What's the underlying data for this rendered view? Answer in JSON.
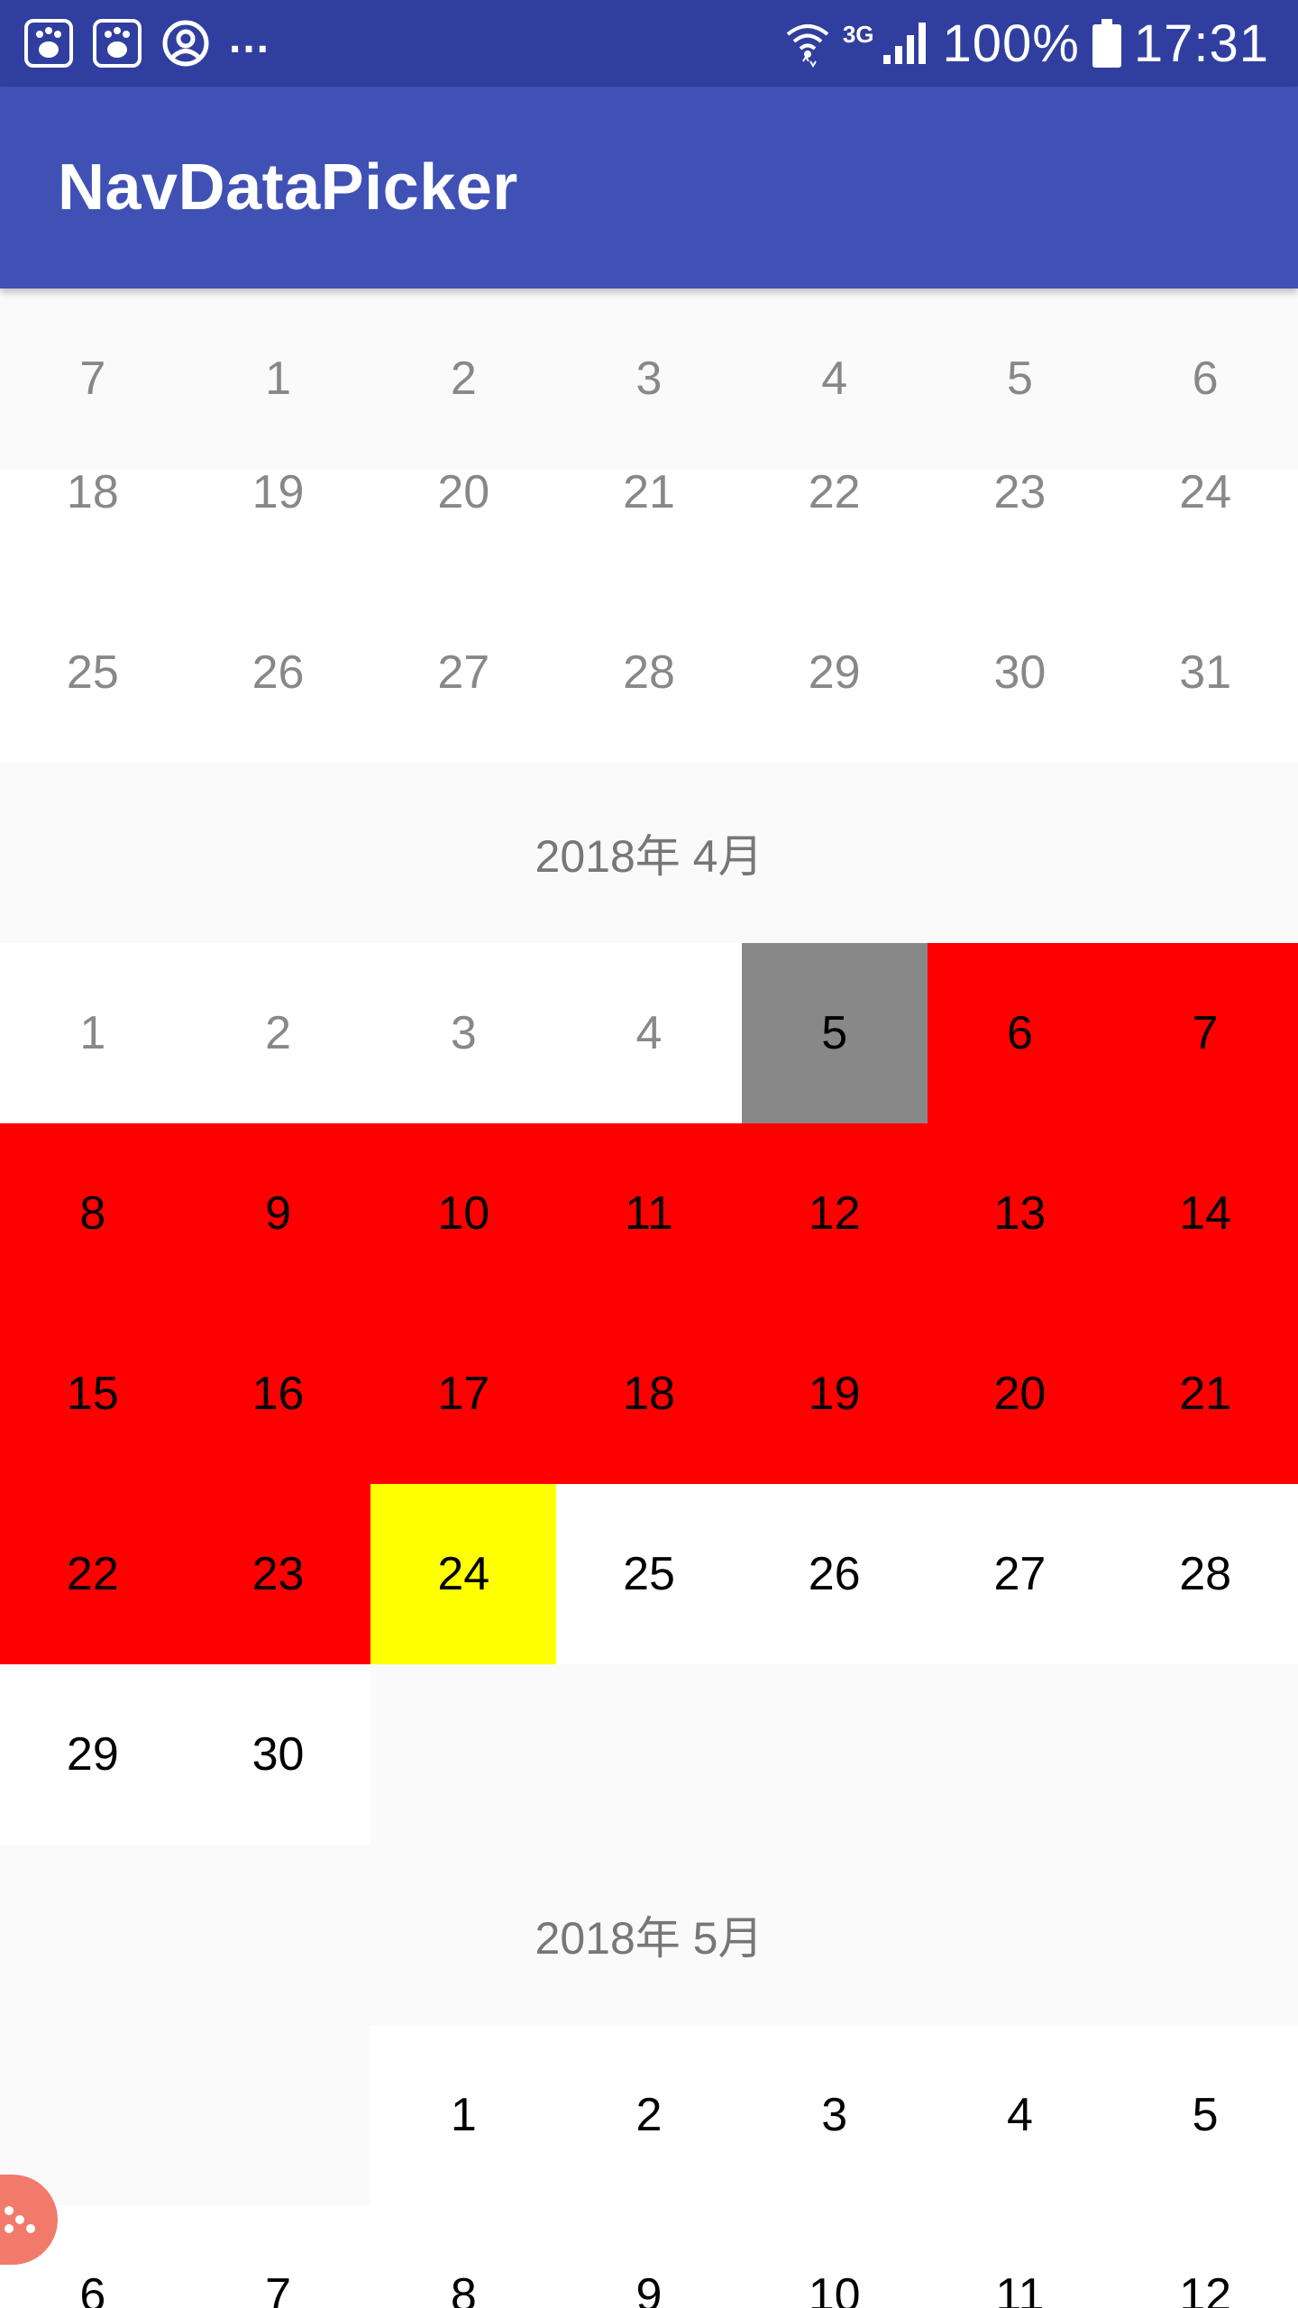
{
  "status_bar": {
    "more": "...",
    "battery": "100%",
    "time": "17:31",
    "network": "3G"
  },
  "app_bar": {
    "title": "NavDataPicker"
  },
  "weekday_header": [
    "7",
    "1",
    "2",
    "3",
    "4",
    "5",
    "6"
  ],
  "march_tail": [
    [
      "18",
      "19",
      "20",
      "21",
      "22",
      "23",
      "24"
    ],
    [
      "25",
      "26",
      "27",
      "28",
      "29",
      "30",
      "31"
    ]
  ],
  "april": {
    "title": "2018年 4月",
    "weeks": [
      [
        "1",
        "2",
        "3",
        "4",
        "5",
        "6",
        "7"
      ],
      [
        "8",
        "9",
        "10",
        "11",
        "12",
        "13",
        "14"
      ],
      [
        "15",
        "16",
        "17",
        "18",
        "19",
        "20",
        "21"
      ],
      [
        "22",
        "23",
        "24",
        "25",
        "26",
        "27",
        "28"
      ],
      [
        "29",
        "30"
      ]
    ]
  },
  "may": {
    "title": "2018年 5月",
    "weeks": [
      [
        "1",
        "2",
        "3",
        "4",
        "5"
      ],
      [
        "6",
        "7",
        "8",
        "9",
        "10",
        "11",
        "12"
      ]
    ]
  },
  "colors": {
    "primary": "#3f51b5",
    "primary_dark": "#303f9f",
    "range": "#ff0000",
    "selected_end": "#ffff00",
    "today": "#888888"
  }
}
